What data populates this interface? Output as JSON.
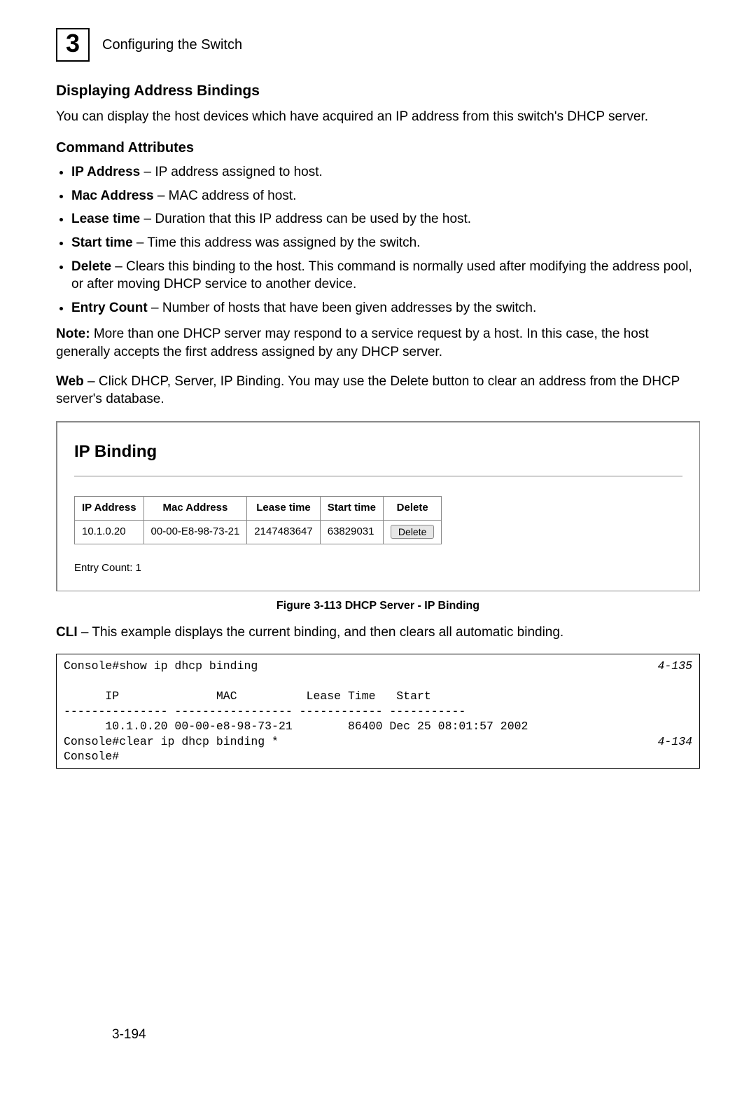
{
  "header": {
    "chapter_number": "3",
    "chapter_title": "Configuring the Switch"
  },
  "section_title": "Displaying Address Bindings",
  "intro": "You can display the host devices which have acquired an IP address from this switch's DHCP server.",
  "cmd_attr_heading": "Command Attributes",
  "attributes": [
    {
      "term": "IP Address",
      "desc": " – IP address assigned to host."
    },
    {
      "term": "Mac Address",
      "desc": " – MAC address of host."
    },
    {
      "term": "Lease time",
      "desc": " – Duration that this IP address can be used by the host."
    },
    {
      "term": "Start time",
      "desc": " – Time this address was assigned by the switch."
    },
    {
      "term": "Delete",
      "desc": " – Clears this binding to the host. This command is normally used after modifying the address pool, or after moving DHCP service to another device."
    },
    {
      "term": "Entry Count",
      "desc": " – Number of hosts that have been given addresses by the switch."
    }
  ],
  "note": {
    "label": "Note:",
    "text": " More than one DHCP server may respond to a service request by a host. In this case, the host generally accepts the first address assigned by any DHCP server."
  },
  "web": {
    "label": "Web",
    "text": " – Click DHCP, Server, IP Binding. You may use the Delete button to clear an address from the DHCP server's database."
  },
  "screenshot": {
    "title": "IP Binding",
    "columns": [
      "IP Address",
      "Mac Address",
      "Lease time",
      "Start time",
      "Delete"
    ],
    "row": {
      "ip": "10.1.0.20",
      "mac": "00-00-E8-98-73-21",
      "lease": "2147483647",
      "start": "63829031",
      "delete_label": "Delete"
    },
    "entry_count": "Entry Count: 1"
  },
  "figure_caption": "Figure 3-113   DHCP Server - IP Binding",
  "cli": {
    "label": "CLI",
    "text": " – This example displays the current binding, and then clears all automatic binding."
  },
  "cli_box": {
    "line1_cmd": "Console#show ip dhcp binding",
    "line1_ref": "4-135",
    "header": "      IP              MAC          Lease Time   Start",
    "divider": "--------------- ----------------- ------------ -----------",
    "data": "      10.1.0.20 00-00-e8-98-73-21        86400 Dec 25 08:01:57 2002",
    "line5_cmd": "Console#clear ip dhcp binding *",
    "line5_ref": "4-134",
    "prompt": "Console#"
  },
  "page_number": "3-194"
}
